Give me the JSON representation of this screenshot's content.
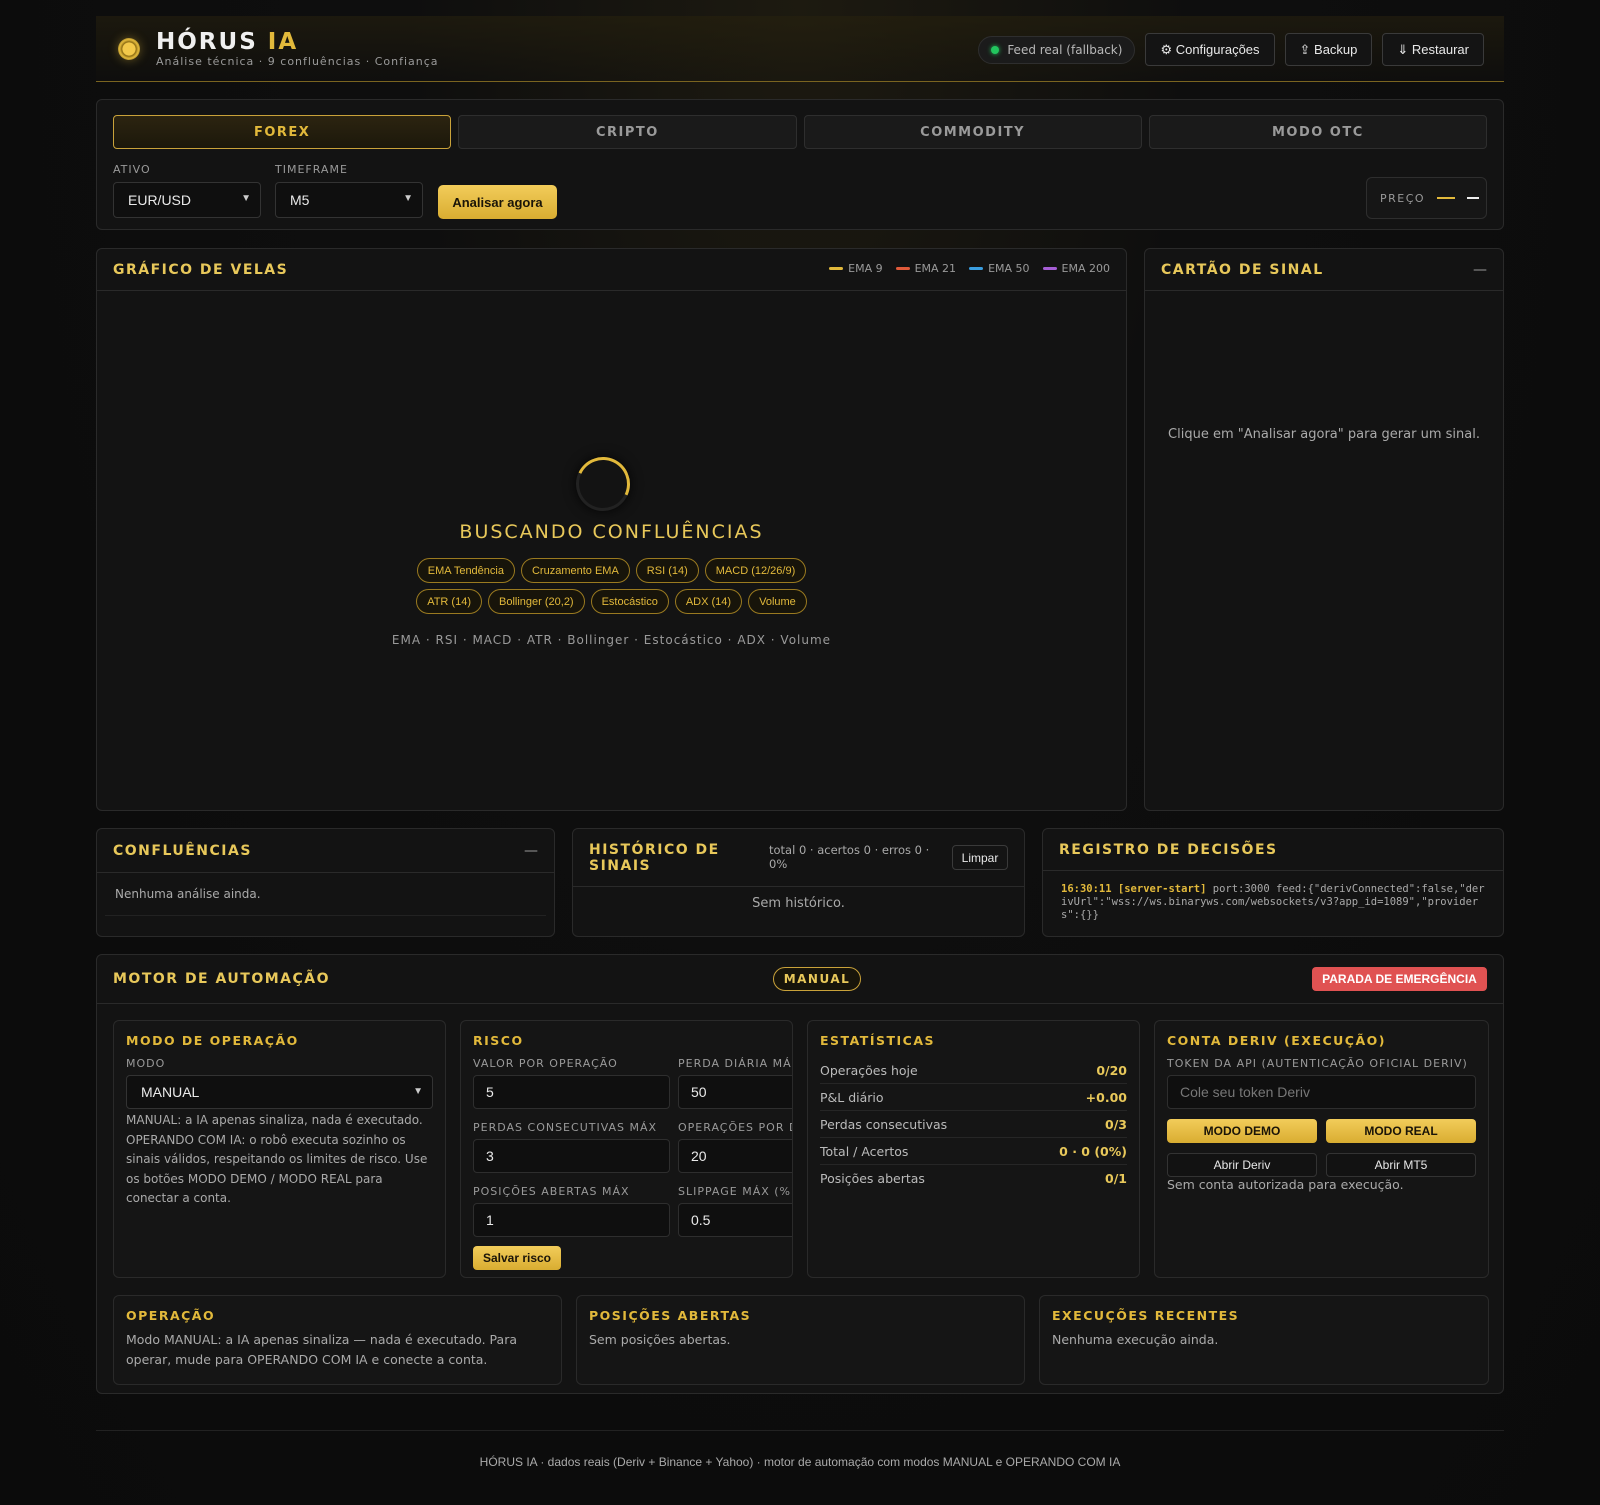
{
  "header": {
    "title": "HÓRUS",
    "title_accent": "IA",
    "subtitle": "Análise técnica · 9 confluências · Confiança",
    "feed_status": "Feed real (fallback)",
    "buttons": {
      "settings": "⚙ Configurações",
      "backup": "⇪ Backup",
      "restore": "⇓ Restaurar"
    },
    "feed_color": "#22c55e"
  },
  "market": {
    "tabs": [
      "FOREX",
      "CRIPTO",
      "COMMODITY",
      "MODO OTC"
    ],
    "active_tab": "FOREX",
    "asset_label": "ATIVO",
    "asset_value": "EUR/USD",
    "timeframe_label": "TIMEFRAME",
    "timeframe_value": "M5",
    "analyze_button": "Analisar agora",
    "price_label": "PREÇO",
    "price_value": "—"
  },
  "chart_panel": {
    "title": "GRÁFICO DE VELAS",
    "legend": [
      {
        "label": "EMA 9",
        "color": "#e2b93b"
      },
      {
        "label": "EMA 21",
        "color": "#e05a3a"
      },
      {
        "label": "EMA 50",
        "color": "#3a9ee0"
      },
      {
        "label": "EMA 200",
        "color": "#a65ed6"
      }
    ],
    "loading_title": "BUSCANDO CONFLUÊNCIAS",
    "chips_row1": [
      "EMA Tendência",
      "Cruzamento EMA",
      "RSI (14)",
      "MACD (12/26/9)"
    ],
    "chips_row2": [
      "ATR (14)",
      "Bollinger (20,2)",
      "Estocástico",
      "ADX (14)",
      "Volume"
    ],
    "indicators_line": "EMA · RSI · MACD · ATR · Bollinger · Estocástico · ADX · Volume"
  },
  "signal_card": {
    "title": "CARTÃO DE SINAL",
    "dash": "—",
    "hint": "Clique em \"Analisar agora\" para gerar um sinal."
  },
  "confluences": {
    "title": "CONFLUÊNCIAS",
    "dash": "—",
    "empty": "Nenhuma análise ainda."
  },
  "history": {
    "title": "HISTÓRICO DE SINAIS",
    "stats": "total 0 · acertos 0 · erros 0 · 0%",
    "clear_button": "Limpar",
    "empty": "Sem histórico."
  },
  "decisions": {
    "title": "REGISTRO DE DECISÕES",
    "log_time": "16:30:11",
    "log_tag": "[server-start]",
    "log_text": "port:3000 feed:{\"derivConnected\":false,\"derivUrl\":\"wss://ws.binaryws.com/websockets/v3?app_id=1089\",\"providers\":{}}"
  },
  "automation": {
    "title": "MOTOR DE AUTOMAÇÃO",
    "mode_pill": "MANUAL",
    "emergency_button": "PARADA DE EMERGÊNCIA",
    "operation_mode": {
      "title": "MODO DE OPERAÇÃO",
      "label": "MODO",
      "value": "MANUAL",
      "description": "MANUAL: a IA apenas sinaliza, nada é executado. OPERANDO COM IA: o robô executa sozinho os sinais válidos, respeitando os limites de risco. Use os botões MODO DEMO / MODO REAL para conectar a conta."
    },
    "risk": {
      "title": "RISCO",
      "value_per_op_label": "VALOR POR OPERAÇÃO",
      "value_per_op": "5",
      "daily_loss_label": "PERDA DIÁRIA MÁXIMA",
      "daily_loss": "50",
      "consec_losses_label": "PERDAS CONSECUTIVAS MÁX",
      "consec_losses": "3",
      "ops_per_day_label": "OPERAÇÕES POR DIA",
      "ops_per_day": "20",
      "open_positions_label": "POSIÇÕES ABERTAS MÁX",
      "open_positions": "1",
      "slippage_label": "SLIPPAGE MÁX (%)",
      "slippage": "0.5",
      "save_button": "Salvar risco"
    },
    "stats": {
      "title": "ESTATÍSTICAS",
      "rows": [
        {
          "label": "Operações hoje",
          "value": "0/20"
        },
        {
          "label": "P&L diário",
          "value": "+0.00"
        },
        {
          "label": "Perdas consecutivas",
          "value": "0/3"
        },
        {
          "label": "Total / Acertos",
          "value": "0 · 0 (0%)"
        },
        {
          "label": "Posições abertas",
          "value": "0/1"
        }
      ]
    },
    "deriv": {
      "title": "CONTA DERIV (EXECUÇÃO)",
      "token_label": "TOKEN DA API (AUTENTICAÇÃO OFICIAL DERIV)",
      "token_placeholder": "Cole seu token Deriv",
      "demo_button": "MODO DEMO",
      "real_button": "MODO REAL",
      "open_deriv": "Abrir Deriv",
      "open_mt5": "Abrir MT5",
      "status": "Sem conta autorizada para execução."
    },
    "operation": {
      "title": "OPERAÇÃO",
      "text": "Modo MANUAL: a IA apenas sinaliza — nada é executado. Para operar, mude para OPERANDO COM IA e conecte a conta."
    },
    "open_positions": {
      "title": "POSIÇÕES ABERTAS",
      "text": "Sem posições abertas."
    },
    "recent_executions": {
      "title": "EXECUÇÕES RECENTES",
      "text": "Nenhuma execução ainda."
    }
  },
  "footer": "HÓRUS IA · dados reais (Deriv + Binance + Yahoo) · motor de automação com modos MANUAL e OPERANDO COM IA"
}
